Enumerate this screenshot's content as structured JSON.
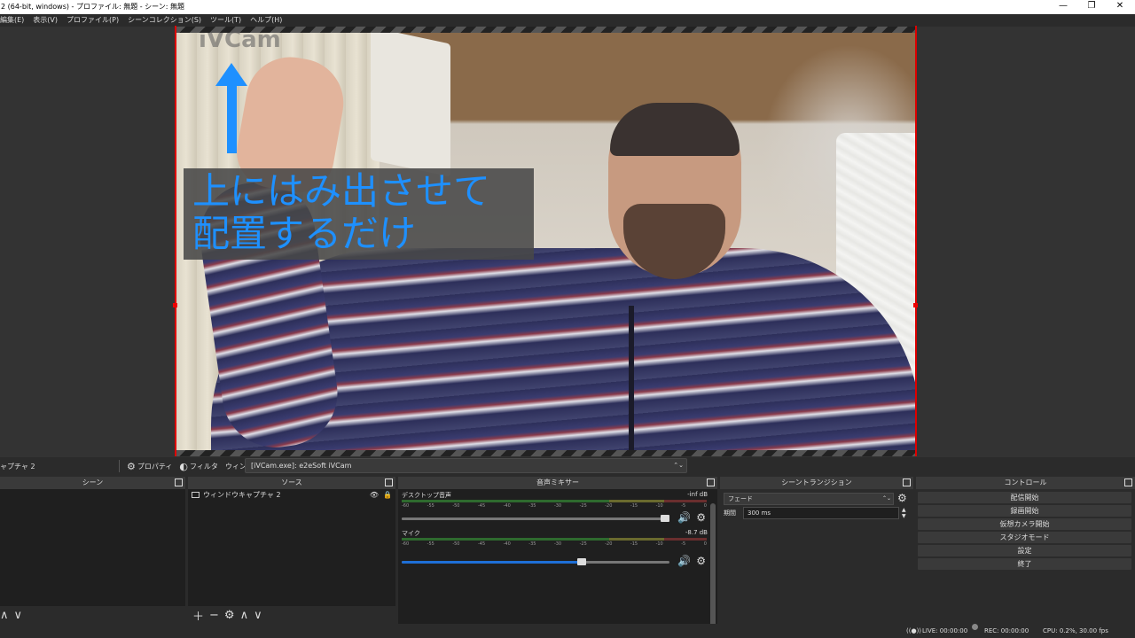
{
  "window": {
    "title": "2 (64-bit, windows) - プロファイル: 無題 - シーン: 無題",
    "minimize": "—",
    "maximize": "❐",
    "close": "✕"
  },
  "menu": [
    "編集(E)",
    "表示(V)",
    "プロファイル(P)",
    "シーンコレクション(S)",
    "ツール(T)",
    "ヘルプ(H)"
  ],
  "preview": {
    "watermark": "iVCam",
    "caption_line1": "上にはみ出させて",
    "caption_line2": "配置するだけ",
    "caption_color": "#1e90ff"
  },
  "source_toolbar": {
    "source_name": "ャプチャ 2",
    "properties_label": "プロパティ",
    "filters_label": "フィルタ",
    "window_label": "ウィンドウ",
    "window_value": "[iVCam.exe]: e2eSoft iVCam"
  },
  "docks": {
    "scenes_title": "シーン",
    "sources_title": "ソース",
    "mixer_title": "音声ミキサー",
    "transitions_title": "シーントランジション",
    "controls_title": "コントロール"
  },
  "sources": {
    "items": [
      {
        "label": "ウィンドウキャプチャ 2"
      }
    ]
  },
  "mixer": {
    "channels": [
      {
        "name": "デスクトップ音声",
        "db": "-inf dB",
        "volume": 1.0
      },
      {
        "name": "マイク",
        "db": "-8.7 dB",
        "volume": 0.69
      }
    ],
    "ticks": [
      "-60",
      "-55",
      "-50",
      "-45",
      "-40",
      "-35",
      "-30",
      "-25",
      "-20",
      "-15",
      "-10",
      "-5",
      "0"
    ]
  },
  "transitions": {
    "selected": "フェード",
    "duration_label": "期間",
    "duration_value": "300 ms"
  },
  "controls": {
    "buttons": [
      "配信開始",
      "録画開始",
      "仮想カメラ開始",
      "スタジオモード",
      "設定",
      "終了"
    ]
  },
  "status": {
    "live": "LIVE: 00:00:00",
    "rec": "REC: 00:00:00",
    "cpu": "CPU: 0.2%, 30.00 fps"
  }
}
